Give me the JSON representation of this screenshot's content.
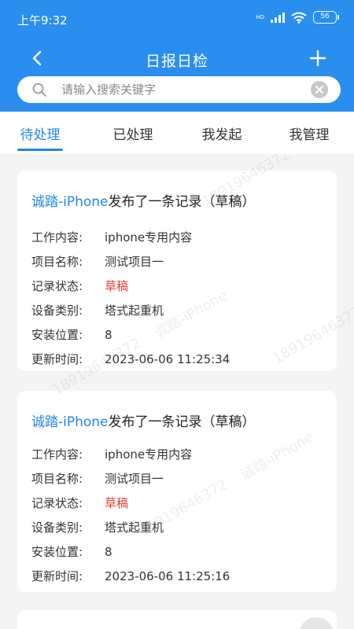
{
  "status_bar": {
    "time": "上午9:32",
    "hd": "HD",
    "battery": "56"
  },
  "nav": {
    "title": "日报日检"
  },
  "search": {
    "placeholder": "请输入搜索关键字",
    "value": ""
  },
  "tabs": [
    {
      "label": "待处理",
      "active": true
    },
    {
      "label": "已处理",
      "active": false
    },
    {
      "label": "我发起",
      "active": false
    },
    {
      "label": "我管理",
      "active": false
    }
  ],
  "cards": [
    {
      "author": "诚踏-iPhone",
      "title_rest": "发布了一条记录（草稿）",
      "fields": [
        {
          "label": "工作内容:",
          "value": "iphone专用内容"
        },
        {
          "label": "项目名称:",
          "value": "测试项目一"
        },
        {
          "label": "记录状态:",
          "value": "草稿"
        },
        {
          "label": "设备类别:",
          "value": "塔式起重机"
        },
        {
          "label": "安装位置:",
          "value": "8"
        },
        {
          "label": "更新时间:",
          "value": "2023-06-06 11:25:34"
        }
      ]
    },
    {
      "author": "诚踏-iPhone",
      "title_rest": "发布了一条记录（草稿）",
      "fields": [
        {
          "label": "工作内容:",
          "value": "iphone专用内容"
        },
        {
          "label": "项目名称:",
          "value": "测试项目一"
        },
        {
          "label": "记录状态:",
          "value": "草稿"
        },
        {
          "label": "设备类别:",
          "value": "塔式起重机"
        },
        {
          "label": "安装位置:",
          "value": "8"
        },
        {
          "label": "更新时间:",
          "value": "2023-06-06 11:25:16"
        }
      ]
    }
  ],
  "watermark": {
    "name": "诚踏-iPhone",
    "phone": "18919646372"
  },
  "colors": {
    "primary": "#2a8eee",
    "accent": "#1e88e5",
    "status_draft": "#e53935"
  }
}
